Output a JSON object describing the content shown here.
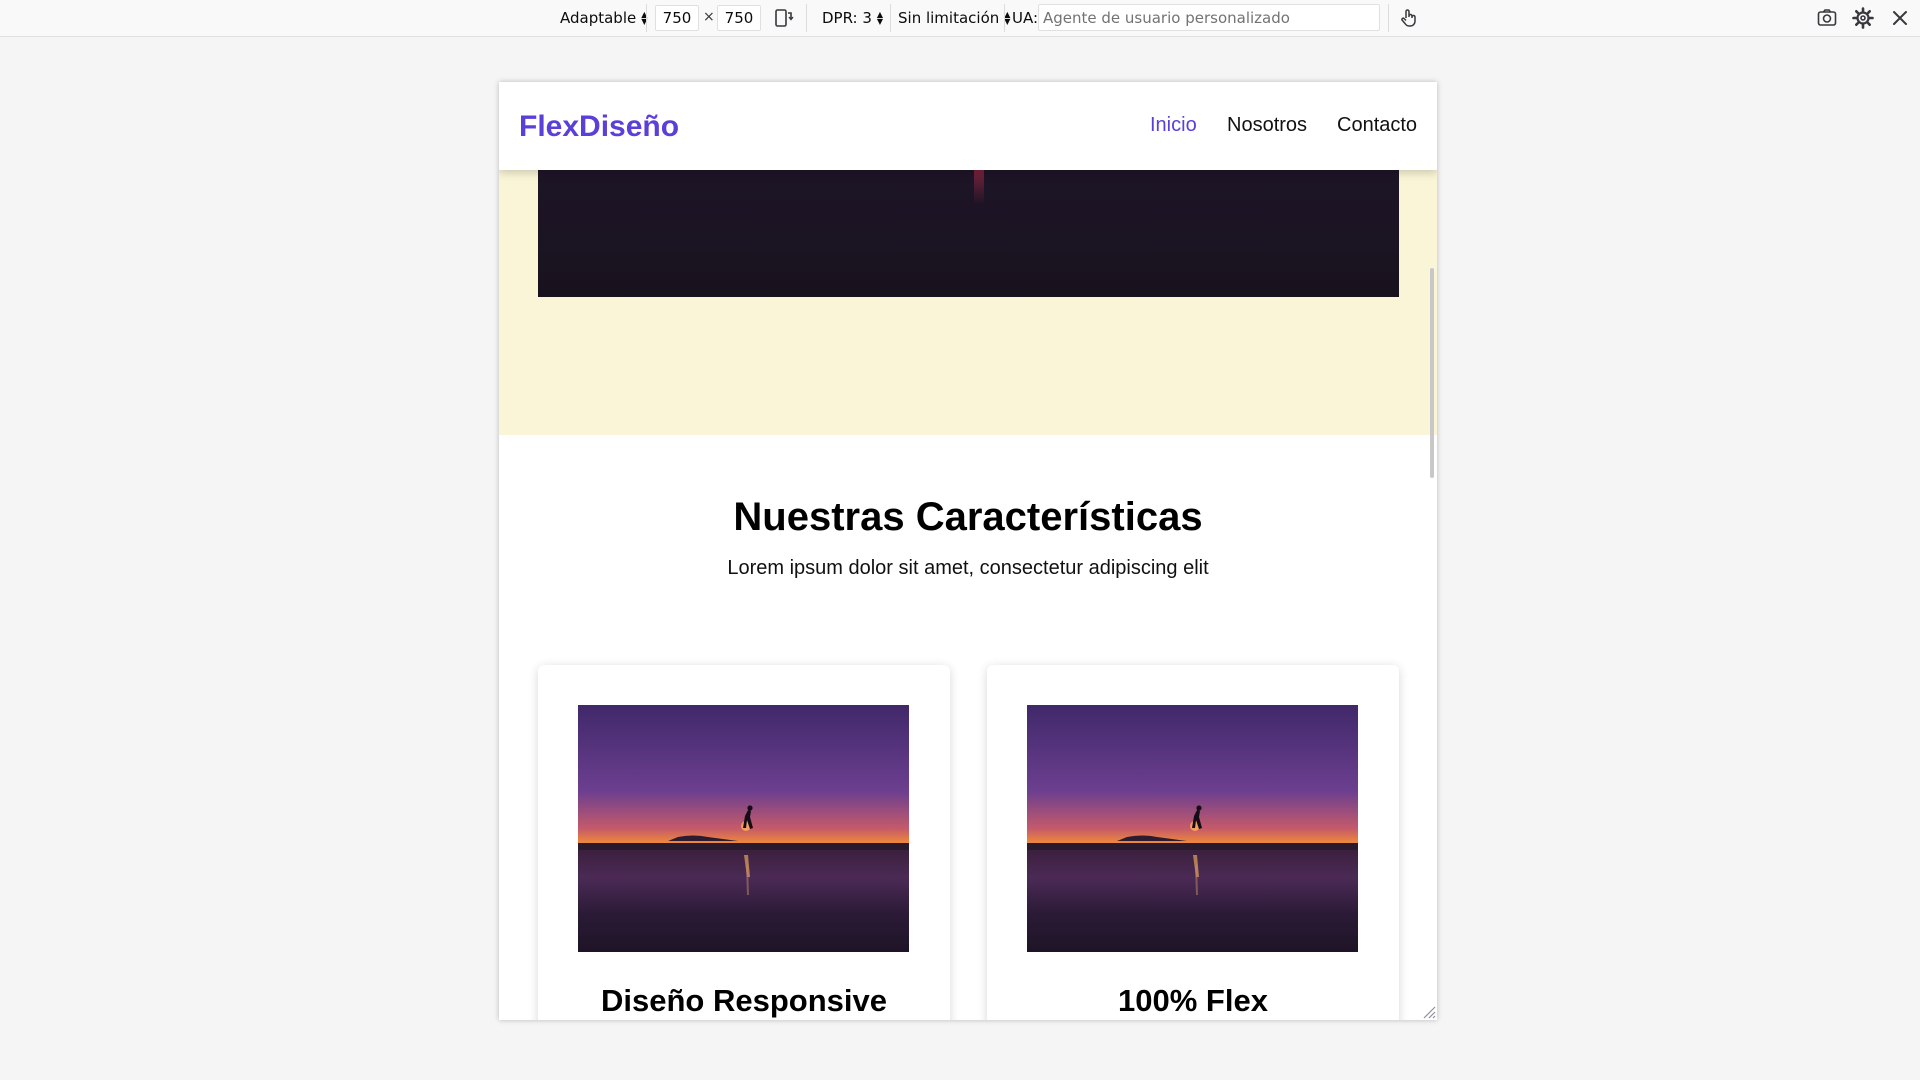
{
  "toolbar": {
    "device_label": "Adaptable",
    "width_value": "750",
    "times_symbol": "×",
    "height_value": "750",
    "dpr_label": "DPR: 3",
    "throttle_label": "Sin limitación",
    "ua_label": "UA:",
    "ua_placeholder": "Agente de usuario personalizado",
    "icons": [
      "rotate-icon",
      "touch-icon",
      "screenshot-icon",
      "settings-icon",
      "close-icon"
    ]
  },
  "site": {
    "logo": "FlexDiseño",
    "nav": [
      {
        "label": "Inicio",
        "active": true
      },
      {
        "label": "Nosotros",
        "active": false
      },
      {
        "label": "Contacto",
        "active": false
      }
    ],
    "features": {
      "title": "Nuestras Características",
      "subtitle": "Lorem ipsum dolor sit amet, consectetur adipiscing elit",
      "cards": [
        {
          "title": "Diseño Responsive"
        },
        {
          "title": "100% Flex"
        }
      ]
    }
  },
  "colors": {
    "accent": "#5a3fd8",
    "hero_background": "#faf5d7",
    "page_background": "#f5f5f5"
  }
}
